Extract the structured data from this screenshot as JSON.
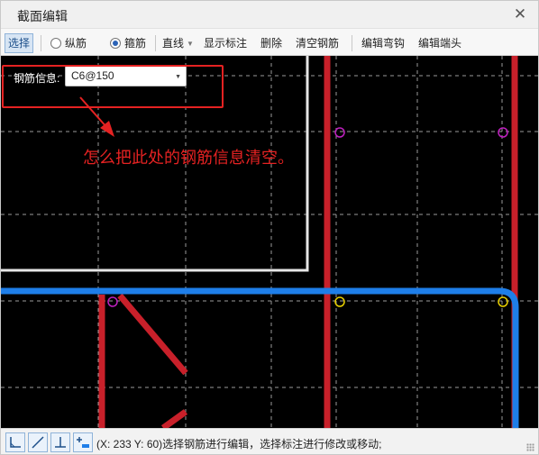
{
  "window": {
    "title": "截面编辑",
    "close_glyph": "✕"
  },
  "toolbar": {
    "select": "选择",
    "longitudinal": "纵筋",
    "stirrup": "箍筋",
    "line": "直线",
    "show_annotation": "显示标注",
    "delete": "删除",
    "clear_rebar": "清空钢筋",
    "edit_hook": "编辑弯钩",
    "edit_end": "编辑端头",
    "active_radio": "stirrup"
  },
  "rebar_info": {
    "label": "钢筋信息:",
    "value": "C6@150"
  },
  "annotation": {
    "text": "怎么把此处的钢筋信息清空。",
    "color": "#e52222"
  },
  "status": {
    "text": "(X: 233 Y: 60)选择钢筋进行编辑，选择标注进行修改或移动;"
  },
  "colors": {
    "canvas": "#000000",
    "red_rebar": "#c8202a",
    "blue_rebar": "#1e7ee8",
    "magenta_point": "#c020c0",
    "yellow_point": "#e8d000",
    "section_edge": "#e6e6e6",
    "grid": "#9a9a9a"
  },
  "icons": [
    "close-icon",
    "radio-icon",
    "chevron-down-icon",
    "angle-tool-icon",
    "line-tool-icon",
    "perpendicular-tool-icon",
    "add-tool-icon",
    "resize-grip-icon"
  ]
}
